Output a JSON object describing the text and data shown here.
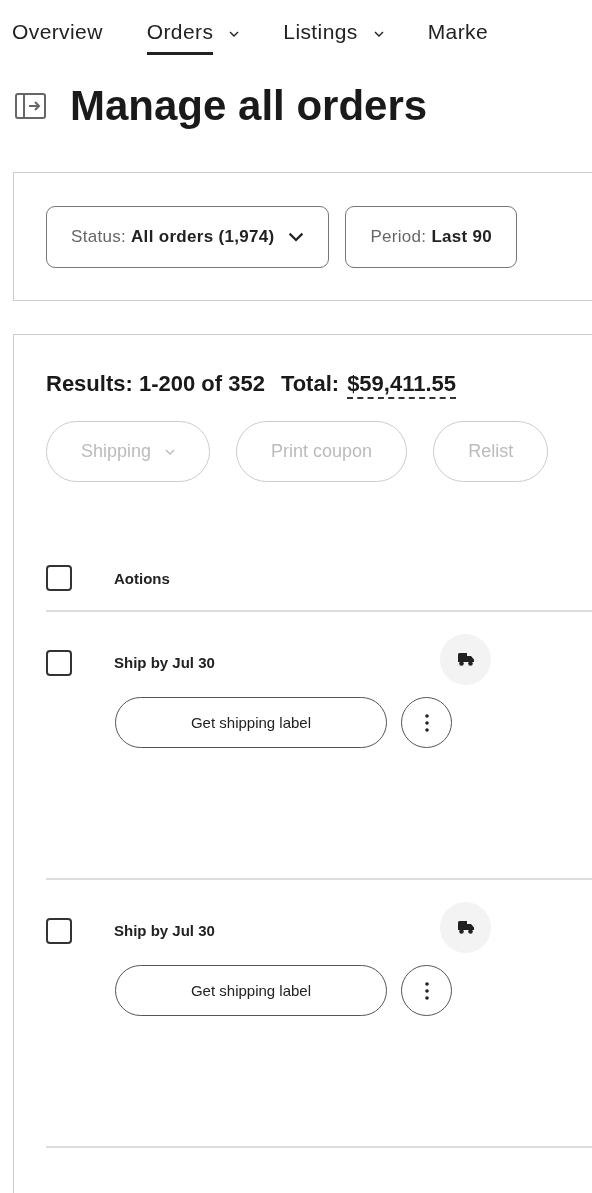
{
  "nav": {
    "tabs": [
      {
        "label": "Overview",
        "selected": false,
        "dropdown": false
      },
      {
        "label": "Orders",
        "selected": true,
        "dropdown": true
      },
      {
        "label": "Listings",
        "selected": false,
        "dropdown": true
      },
      {
        "label": "Marke",
        "selected": false,
        "dropdown": false
      }
    ]
  },
  "page": {
    "title": "Manage all orders"
  },
  "filters": [
    {
      "text": "Status: **All orders (1,974)**",
      "dropdown": true
    },
    {
      "text": "Period: **Last 90**",
      "dropdown": false
    }
  ],
  "results": {
    "summary": "Results: 1-200 of 352",
    "total_label": "Total:",
    "total_value": "$59,411.55"
  },
  "bulk_actions": [
    {
      "label": "Shipping",
      "dropdown": true,
      "disabled": true
    },
    {
      "label": "Print coupon",
      "dropdown": false,
      "disabled": true
    },
    {
      "label": "Relist",
      "dropdown": false,
      "disabled": true
    }
  ],
  "table": {
    "header": {
      "checked": false,
      "label": "Aotions"
    },
    "rows": [
      {
        "checked": false,
        "ship_by": "Ship by Jul 30",
        "action": "Get shipping label"
      },
      {
        "checked": false,
        "ship_by": "Ship by Jul 30",
        "action": "Get shipping label"
      }
    ]
  }
}
